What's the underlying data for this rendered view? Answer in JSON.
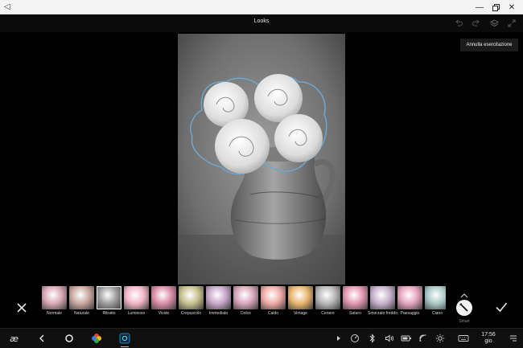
{
  "app": {
    "title": "Looks"
  },
  "tooltip": {
    "text": "Annulla esercitazione"
  },
  "filters": [
    {
      "label": "Normale",
      "tint": "#d8a8b6",
      "selected": false
    },
    {
      "label": "Naturale",
      "tint": "#c9a79e",
      "selected": false
    },
    {
      "label": "Ritratto",
      "tint": "#9c9c9c",
      "selected": true
    },
    {
      "label": "Luminoso",
      "tint": "#f2b6c8",
      "selected": false
    },
    {
      "label": "Vivido",
      "tint": "#d98ca7",
      "selected": false
    },
    {
      "label": "Crepuscolo",
      "tint": "#c8c08d",
      "selected": false
    },
    {
      "label": "Immediato",
      "tint": "#c7a7c9",
      "selected": false
    },
    {
      "label": "Dolce",
      "tint": "#d8a6ba",
      "selected": false
    },
    {
      "label": "Caldo",
      "tint": "#eeaaa4",
      "selected": false
    },
    {
      "label": "Vintage",
      "tint": "#e8b56e",
      "selected": false
    },
    {
      "label": "Cenere",
      "tint": "#b7b7b7",
      "selected": false
    },
    {
      "label": "Saturo",
      "tint": "#e397b2",
      "selected": false
    },
    {
      "label": "Smorzato freddo",
      "tint": "#c6b1cc",
      "selected": false
    },
    {
      "label": "Paesaggio",
      "tint": "#e5a3bd",
      "selected": false
    },
    {
      "label": "Ciano",
      "tint": "#a9c6c6",
      "selected": false
    }
  ],
  "smart": {
    "label": "Smart"
  },
  "taskbar": {
    "time": "17:56",
    "day": "gio"
  },
  "colors": {
    "selection_outline": "#7fb3d8",
    "accent": "#1e88c8"
  }
}
